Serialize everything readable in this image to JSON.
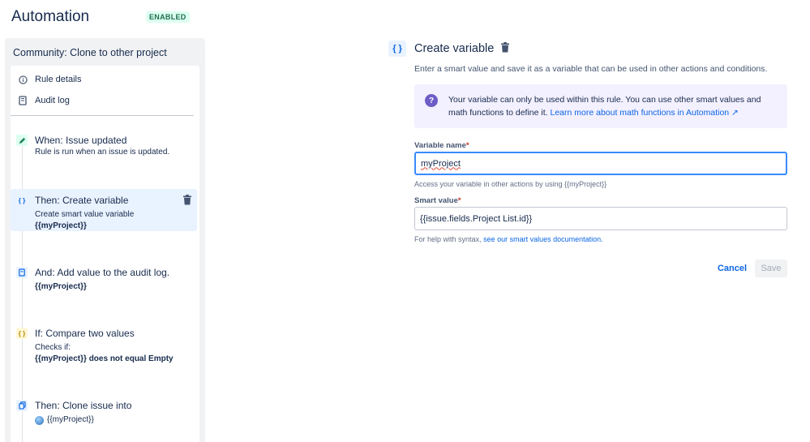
{
  "header": {
    "title": "Automation",
    "status_badge": "ENABLED"
  },
  "sidebar": {
    "rule_title": "Community: Clone to other project",
    "meta_items": [
      {
        "label": "Rule details",
        "icon": "info-icon"
      },
      {
        "label": "Audit log",
        "icon": "audit-log-icon"
      }
    ],
    "steps": [
      {
        "title": "When: Issue updated",
        "desc": "Rule is run when an issue is updated.",
        "icon": "pencil-icon"
      },
      {
        "title": "Then: Create variable",
        "desc": "Create smart value variable",
        "value": "{{myProject}}",
        "icon": "curly-braces-icon",
        "selected": true
      },
      {
        "title": "And: Add value to the audit log.",
        "value": "{{myProject}}",
        "icon": "audit-log-icon"
      },
      {
        "title": "If: Compare two values",
        "desc": "Checks if:",
        "value": "{{myProject}} does not equal Empty",
        "icon": "curly-braces-icon"
      },
      {
        "title": "Then: Clone issue into",
        "value": "{{myProject}}",
        "icon": "clone-icon"
      }
    ]
  },
  "main": {
    "title": "Create variable",
    "description": "Enter a smart value and save it as a variable that can be used in other actions and conditions.",
    "info": {
      "line1": "Your variable can only be used within this rule. You can use other smart values and",
      "line2_prefix": "math functions to define it.",
      "link": "Learn more about math functions in Automation ↗"
    },
    "variable_name": {
      "label": "Variable name",
      "required": "*",
      "value": "myProject",
      "helper": "Access your variable in other actions by using {{myProject}}"
    },
    "smart_value": {
      "label": "Smart value",
      "required": "*",
      "value": "{{issue.fields.Project List.id}}",
      "helper_prefix": "For help with syntax,",
      "helper_link": "see our smart values documentation."
    },
    "cancel_label": "Cancel",
    "save_label": "Save"
  },
  "colors": {
    "accent": "#0c66e4",
    "enabled_green": "#216e4e",
    "selected_bg": "#e9f2ff",
    "info_bg": "#f3f0ff"
  }
}
